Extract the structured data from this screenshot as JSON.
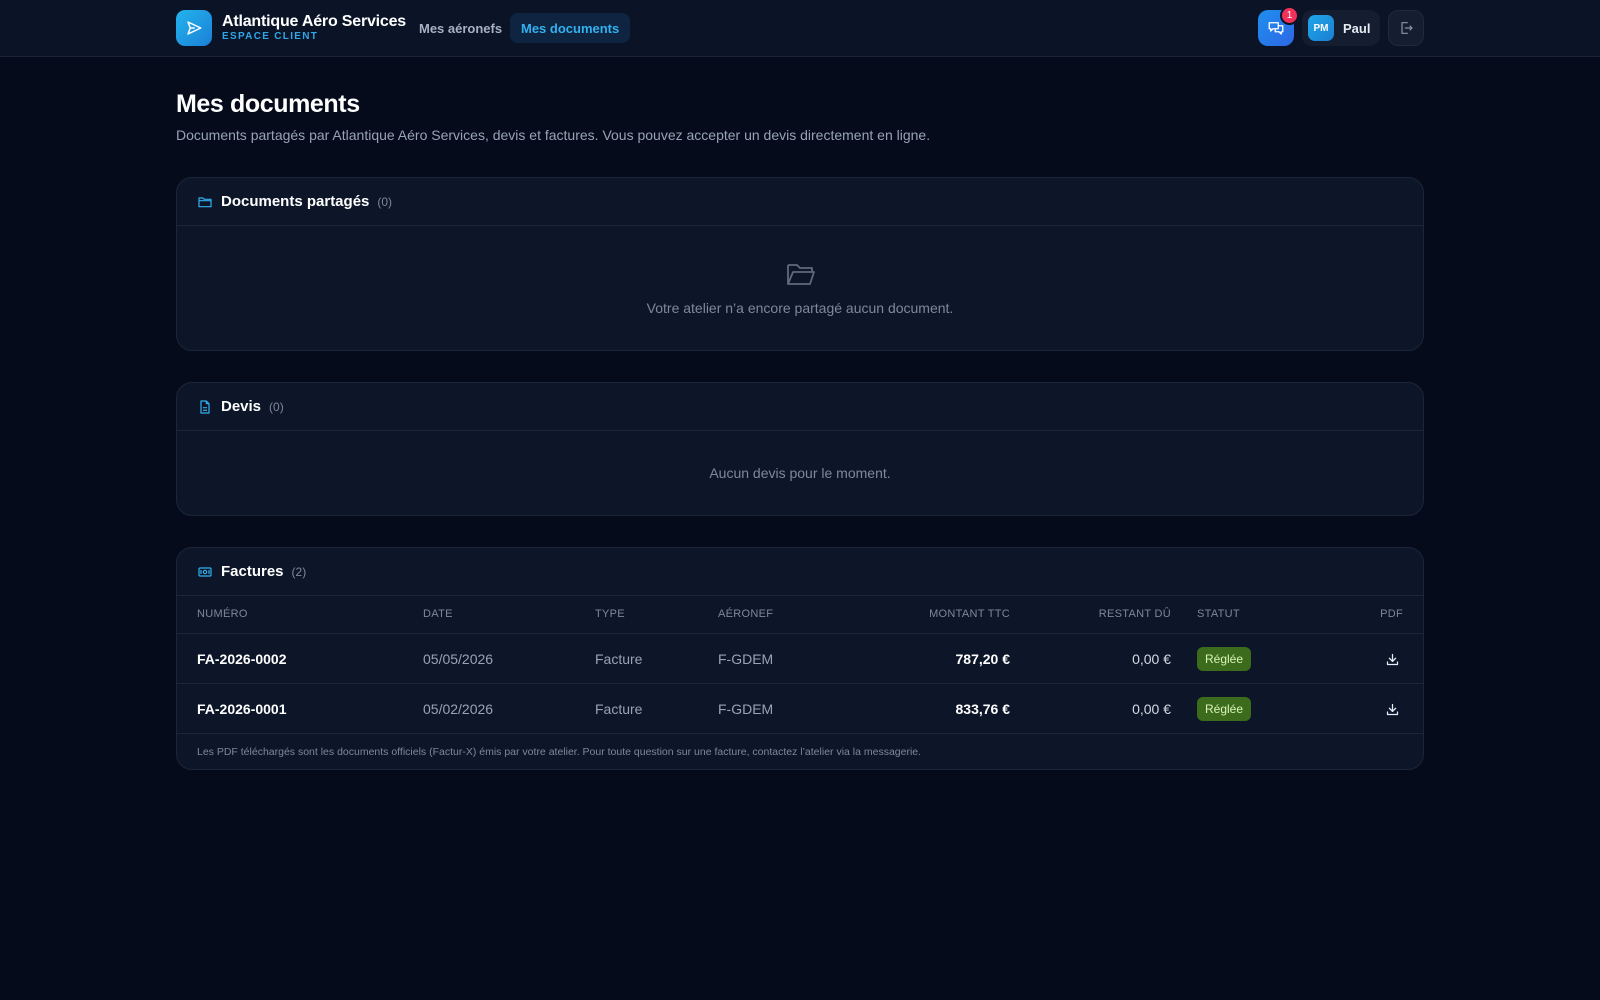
{
  "header": {
    "brand_name": "Atlantique Aéro Services",
    "brand_sub": "ESPACE CLIENT",
    "nav": [
      {
        "label": "Mes aéronefs",
        "active": false
      },
      {
        "label": "Mes documents",
        "active": true
      }
    ],
    "chat_badge": "1",
    "user_initials": "PM",
    "user_name": "Paul",
    "icons": {
      "logo": "send-icon",
      "chat": "chat-icon",
      "logout": "logout-icon"
    }
  },
  "page": {
    "title": "Mes documents",
    "subtitle": "Documents partagés par Atlantique Aéro Services, devis et factures. Vous pouvez accepter un devis directement en ligne."
  },
  "shared": {
    "title": "Documents partagés",
    "count": "(0)",
    "empty": "Votre atelier n’a encore partagé aucun document."
  },
  "devis": {
    "title": "Devis",
    "count": "(0)",
    "empty": "Aucun devis pour le moment."
  },
  "factures": {
    "title": "Factures",
    "count": "(2)",
    "columns": {
      "numero": "NUMÉRO",
      "date": "DATE",
      "type": "TYPE",
      "aeronef": "AÉRONEF",
      "montant": "MONTANT TTC",
      "restant": "RESTANT DÛ",
      "statut": "STATUT",
      "pdf": "PDF"
    },
    "rows": [
      {
        "numero": "FA-2026-0002",
        "date": "05/05/2026",
        "type": "Facture",
        "aeronef": "F-GDEM",
        "montant": "787,20 €",
        "restant": "0,00 €",
        "statut": "Réglée"
      },
      {
        "numero": "FA-2026-0001",
        "date": "05/02/2026",
        "type": "Facture",
        "aeronef": "F-GDEM",
        "montant": "833,76 €",
        "restant": "0,00 €",
        "statut": "Réglée"
      }
    ],
    "note": "Les PDF téléchargés sont les documents officiels (Factur-X) émis par votre atelier. Pour toute question sur une facture, contactez l’atelier via la messagerie."
  },
  "colors": {
    "background": "#050b1a",
    "accent": "#33b0f0",
    "status_paid_bg": "#3d6b1c",
    "badge": "#f0305a"
  }
}
